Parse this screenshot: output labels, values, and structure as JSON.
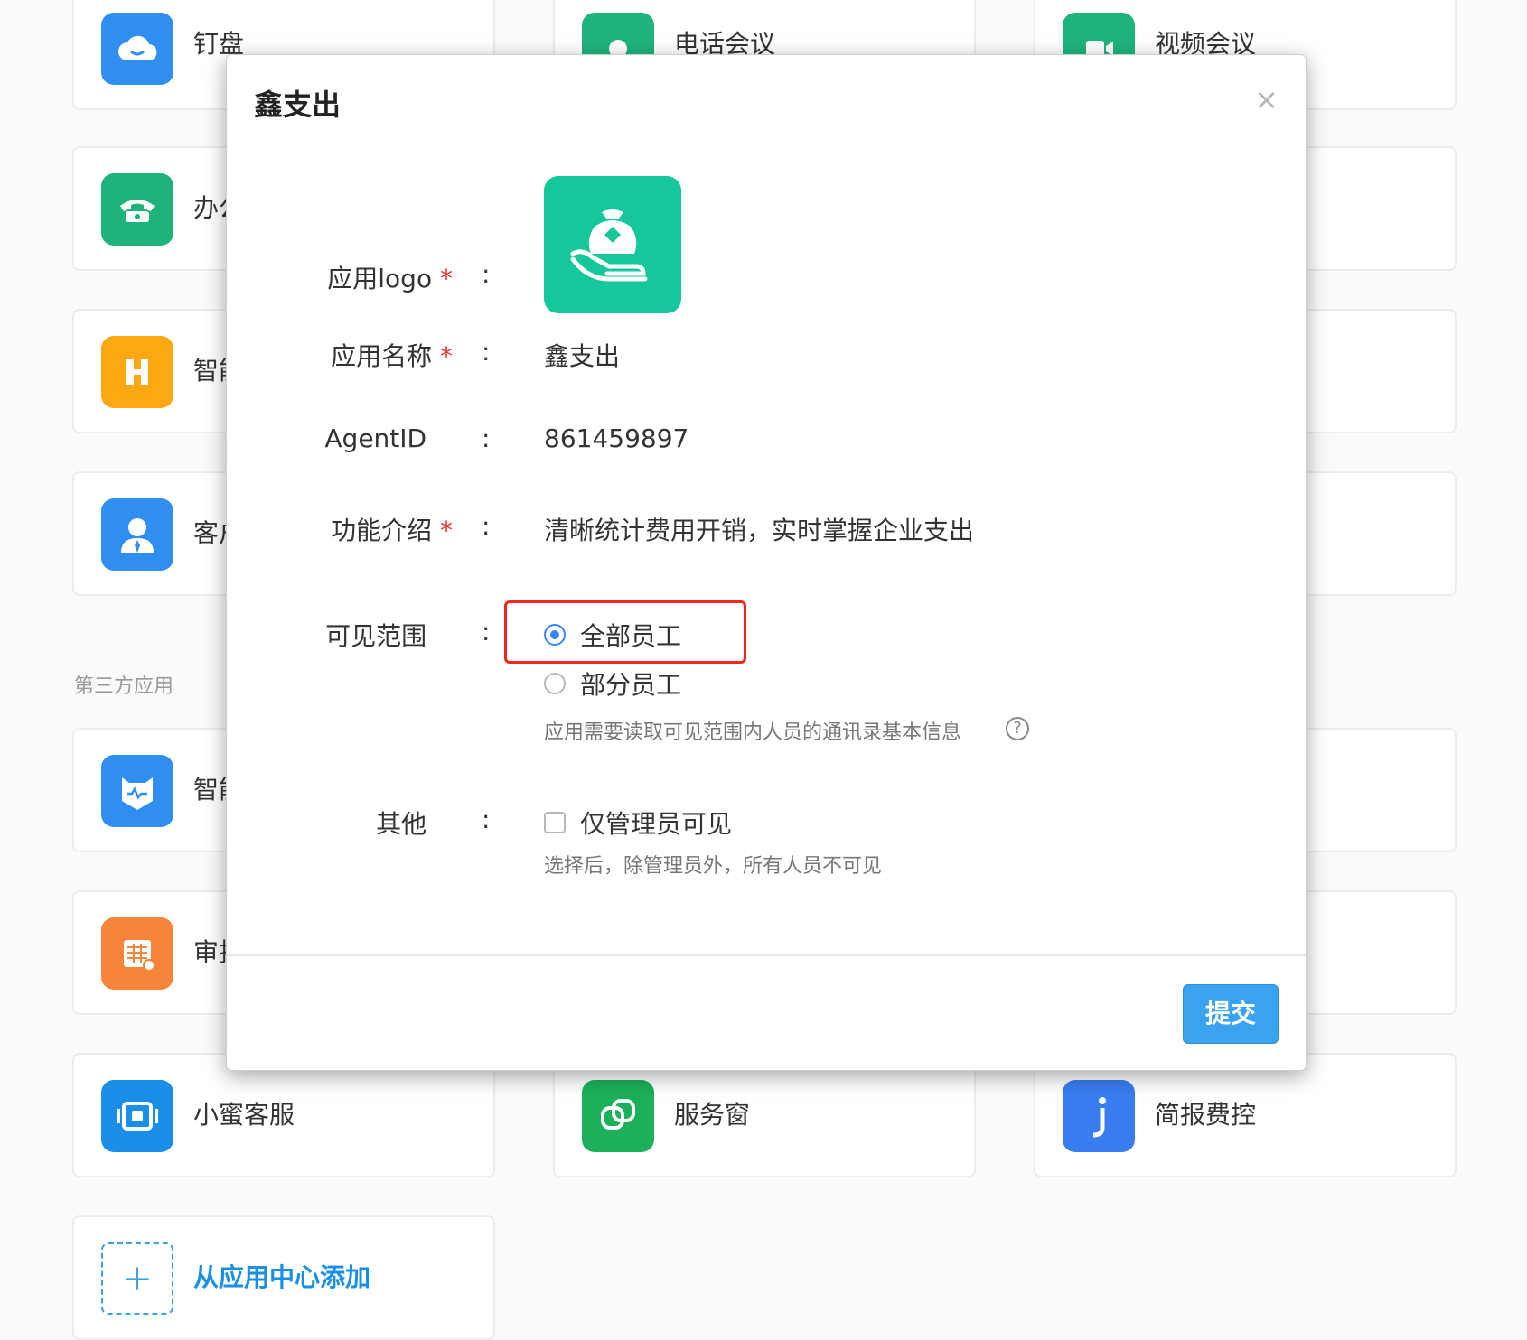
{
  "apps": {
    "row1": [
      "钉盘",
      "电话会议",
      "视频会议"
    ],
    "left_col": [
      "办公",
      "智能",
      "客户",
      "智能",
      "审批"
    ],
    "section_third_party": "第三方应用",
    "row_bottom": [
      "小蜜客服",
      "服务窗",
      "简报费控"
    ],
    "add_from_center": "从应用中心添加",
    "add_icon_glyph": "+"
  },
  "modal": {
    "title": "鑫支出",
    "close_glyph": "×",
    "logo_label": "应用logo",
    "name_label": "应用名称",
    "name_value": "鑫支出",
    "agent_label": "AgentID",
    "agent_value": "861459897",
    "intro_label": "功能介绍",
    "intro_value": "清晰统计费用开销，实时掌握企业支出",
    "scope_label": "可见范围",
    "scope_all": "全部员工",
    "scope_partial": "部分员工",
    "scope_selected": "全部员工",
    "scope_hint": "应用需要读取可见范围内人员的通讯录基本信息",
    "help_glyph": "?",
    "other_label": "其他",
    "admin_only": "仅管理员可见",
    "admin_only_checked": false,
    "admin_hint": "选择后，除管理员外，所有人员不可见",
    "required_mark": "*",
    "colon": ":",
    "submit": "提交"
  },
  "colors": {
    "accent_blue": "#3aa3ef",
    "logo_green": "#15c79a",
    "highlight_red": "#f0271f",
    "required_red": "#e53935"
  },
  "icons": {
    "dingpan": "cloud-icon",
    "phone_meeting": "phone-icon",
    "video_meeting": "video-call-icon",
    "office_phone": "telephone-icon",
    "smart_h": "h-letter-icon",
    "customer": "person-icon",
    "smart_bot": "robot-icon",
    "approval": "calendar-doc-icon",
    "xiaomi": "headset-icon",
    "service_window": "overlap-squares-icon",
    "briefing": "j-letter-icon",
    "xinzhichu": "money-bag-hand-icon"
  }
}
